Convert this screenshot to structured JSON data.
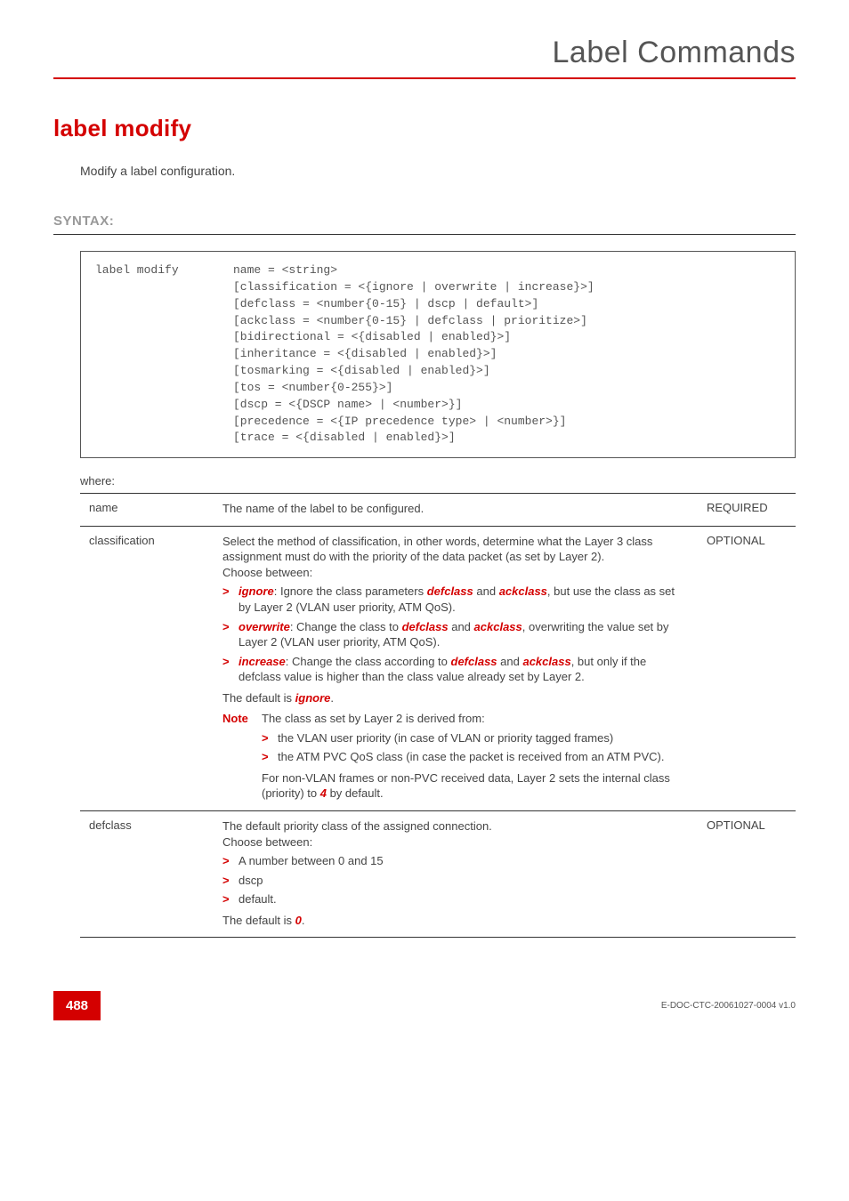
{
  "chapter_title": "Label Commands",
  "command_title": "label modify",
  "command_desc": "Modify a label configuration.",
  "section_syntax_label": "SYNTAX:",
  "syntax": {
    "cmd": "label modify",
    "args": "name = <string>\n[classification = <{ignore | overwrite | increase}>]\n[defclass = <number{0-15} | dscp | default>]\n[ackclass = <number{0-15} | defclass | prioritize>]\n[bidirectional = <{disabled | enabled}>]\n[inheritance = <{disabled | enabled}>]\n[tosmarking = <{disabled | enabled}>]\n[tos = <number{0-255}>]\n[dscp = <{DSCP name> | <number>}]\n[precedence = <{IP precedence type> | <number>}]\n[trace = <{disabled | enabled}>]"
  },
  "where_label": "where:",
  "params": {
    "name": {
      "label": "name",
      "desc": "The name of the label to be configured.",
      "req": "REQUIRED"
    },
    "classification": {
      "label": "classification",
      "intro": "Select the method of classification, in other words, determine what the Layer 3 class assignment must do with the priority of the data packet (as set by Layer 2).\nChoose between:",
      "opt_ignore_key": "ignore",
      "opt_ignore_pre": ": Ignore the class parameters ",
      "opt_ignore_def": "defclass",
      "opt_ignore_and": " and ",
      "opt_ignore_ack": "ackclass",
      "opt_ignore_post": ", but use the class as set by Layer 2 (VLAN user priority, ATM QoS).",
      "opt_overwrite_key": "overwrite",
      "opt_overwrite_pre": ": Change the class to ",
      "opt_overwrite_def": "defclass",
      "opt_overwrite_and": " and ",
      "opt_overwrite_ack": "ackclass",
      "opt_overwrite_post": ", overwriting the value set by Layer 2 (VLAN user priority, ATM QoS).",
      "opt_increase_key": "increase",
      "opt_increase_pre": ": Change the class according to ",
      "opt_increase_def": "defclass",
      "opt_increase_and": " and ",
      "opt_increase_ack": "ackclass",
      "opt_increase_post": ", but only if the defclass value is higher than the class value already set by Layer 2.",
      "default_pre": "The default is ",
      "default_val": "ignore",
      "default_post": ".",
      "note_label": "Note",
      "note_intro": "The class as set by Layer 2 is derived from:",
      "note_b1": "the VLAN user priority (in case of VLAN or priority tagged frames)",
      "note_b2": "the ATM PVC QoS class (in case the packet is received from an ATM PVC).",
      "note_tail_pre": "For non-VLAN frames or non-PVC received data, Layer 2 sets the internal class (priority) to ",
      "note_tail_val": "4",
      "note_tail_post": " by default.",
      "req": "OPTIONAL"
    },
    "defclass": {
      "label": "defclass",
      "intro": "The default priority class of the assigned connection.\nChoose between:",
      "b1": "A number between 0 and 15",
      "b2": "dscp",
      "b3": "default.",
      "default_pre": "The default is ",
      "default_val": "0",
      "default_post": ".",
      "req": "OPTIONAL"
    }
  },
  "footer": {
    "page": "488",
    "docid": "E-DOC-CTC-20061027-0004 v1.0"
  }
}
